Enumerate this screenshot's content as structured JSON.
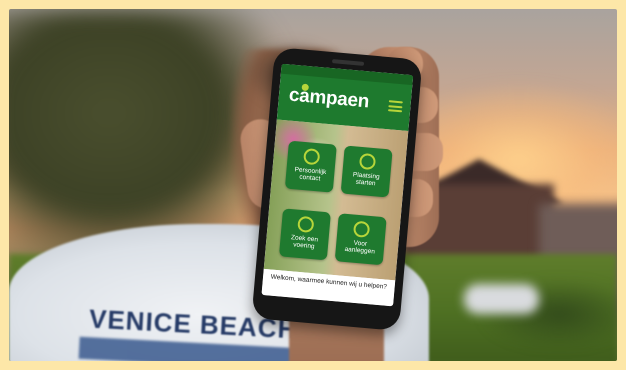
{
  "app": {
    "brand": "campaen",
    "menu_icon": "hamburger-icon",
    "tiles": [
      {
        "label": "Persoonlijk contact",
        "icon": "chat-icon"
      },
      {
        "label": "Plaatsing starten",
        "icon": "plant-icon"
      },
      {
        "label": "Zoek een voering",
        "icon": "location-icon"
      },
      {
        "label": "Voor aanleggen",
        "icon": "leaf-icon"
      }
    ],
    "footer": "Welkom, waarmee kunnen wij u helpen?",
    "colors": {
      "primary": "#1e7a2e",
      "accent": "#b7d53a"
    }
  },
  "shirt_text": "VENICE BEACH"
}
